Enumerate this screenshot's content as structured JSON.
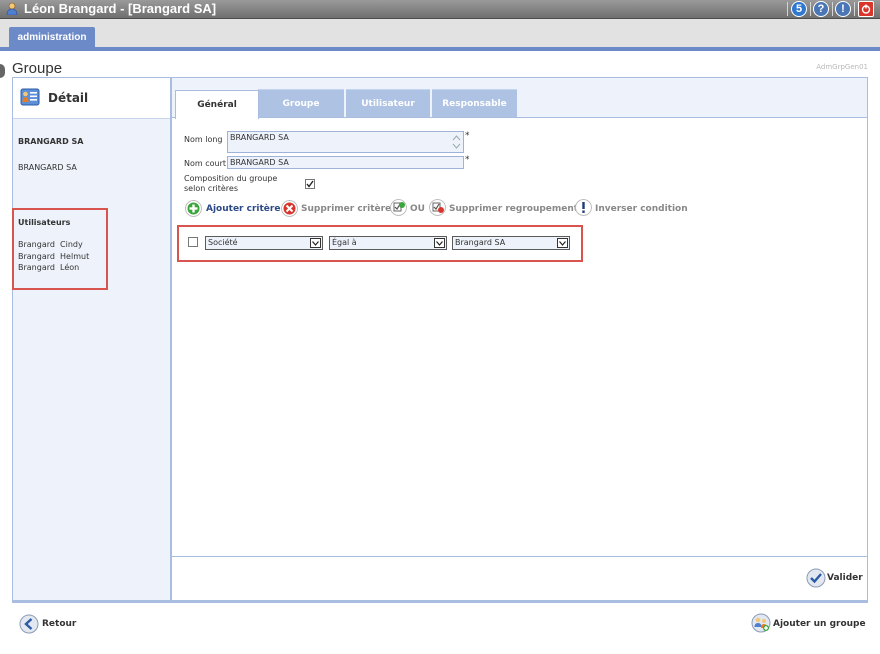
{
  "window": {
    "title": "Léon Brangard - [Brangard SA]",
    "buttons": [
      {
        "name": "notifications-badge",
        "label": "5",
        "color": "#2f78d0"
      },
      {
        "name": "help",
        "label": "?",
        "color": "#4a76b6"
      },
      {
        "name": "info",
        "label": "!",
        "color": "#4a76b6"
      },
      {
        "name": "power",
        "label": "",
        "color": "#d9352d"
      }
    ]
  },
  "nav": {
    "active_tab": "administration"
  },
  "page": {
    "title": "Groupe",
    "code": "AdmGrpGen01"
  },
  "left": {
    "header": "Détail",
    "org_title": "BRANGARD SA",
    "org_name": "BRANGARD SA",
    "users_title": "Utilisateurs",
    "users": [
      "Brangard  Cindy",
      "Brangard  Helmut",
      "Brangard  Léon"
    ]
  },
  "tabs": [
    {
      "label": "Général",
      "active": true
    },
    {
      "label": "Groupe",
      "active": false
    },
    {
      "label": "Utilisateur",
      "active": false
    },
    {
      "label": "Responsable",
      "active": false
    }
  ],
  "form": {
    "nom_long_label": "Nom long",
    "nom_long_value": "BRANGARD SA",
    "nom_court_label": "Nom court",
    "nom_court_value": "BRANGARD SA",
    "required_mark": "*",
    "composition_label_1": "Composition du groupe",
    "composition_label_2": "selon critères",
    "composition_checked": true
  },
  "toolbar": {
    "add": "Ajouter critère",
    "remove": "Supprimer critère",
    "or": "OU",
    "remove_group": "Supprimer regroupement",
    "invert": "Inverser condition"
  },
  "criteria": {
    "field": "Société",
    "operator": "Égal à",
    "value": "Brangard SA"
  },
  "actions": {
    "validate": "Valider",
    "back": "Retour",
    "add_group": "Ajouter un groupe"
  },
  "colors": {
    "accent": "#6d8ac8",
    "highlight": "#d9534f",
    "panel_bg": "#eef3fb"
  }
}
